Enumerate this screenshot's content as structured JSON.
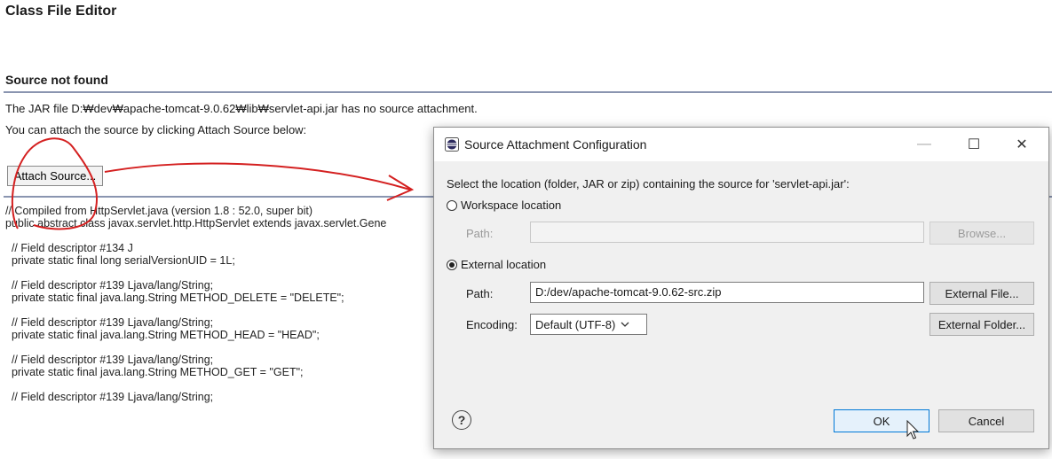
{
  "editor": {
    "title": "Class File Editor",
    "section_title": "Source not found",
    "message_line1": "The JAR file D:₩dev₩apache-tomcat-9.0.62₩lib₩servlet-api.jar has no source attachment.",
    "message_line2": "You can attach the source by clicking Attach Source below:",
    "attach_button": "Attach Source...",
    "code": "// Compiled from HttpServlet.java (version 1.8 : 52.0, super bit)\npublic abstract class javax.servlet.http.HttpServlet extends javax.servlet.Gene\n\n  // Field descriptor #134 J\n  private static final long serialVersionUID = 1L;\n\n  // Field descriptor #139 Ljava/lang/String;\n  private static final java.lang.String METHOD_DELETE = \"DELETE\";\n\n  // Field descriptor #139 Ljava/lang/String;\n  private static final java.lang.String METHOD_HEAD = \"HEAD\";\n\n  // Field descriptor #139 Ljava/lang/String;\n  private static final java.lang.String METHOD_GET = \"GET\";\n\n  // Field descriptor #139 Ljava/lang/String;"
  },
  "dialog": {
    "title": "Source Attachment Configuration",
    "minimize": "—",
    "maximize": "☐",
    "close": "✕",
    "instruction": "Select the location (folder, JAR or zip) containing the source for 'servlet-api.jar':",
    "workspace_label": "Workspace location",
    "workspace_path_label": "Path:",
    "workspace_path_value": "",
    "browse_button": "Browse...",
    "external_label": "External location",
    "external_path_label": "Path:",
    "external_path_value": "D:/dev/apache-tomcat-9.0.62-src.zip",
    "external_file_button": "External File...",
    "encoding_label": "Encoding:",
    "encoding_value": "Default (UTF-8)",
    "external_folder_button": "External Folder...",
    "help_icon": "?",
    "ok_button": "OK",
    "cancel_button": "Cancel"
  },
  "icons": {
    "dialog_icon": "eclipse-icon",
    "help": "help-icon",
    "cursor": "mouse-pointer-icon",
    "select_arrow": "chevron-down-icon"
  },
  "annotation_color": "#d42020"
}
